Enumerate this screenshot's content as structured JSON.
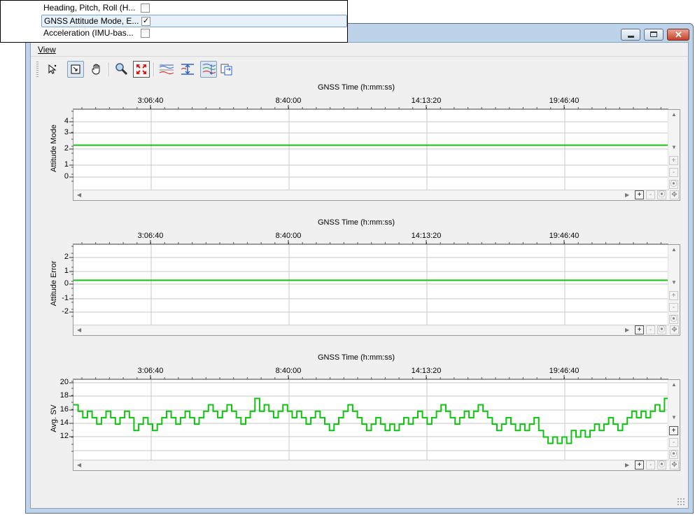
{
  "menu": {
    "view_label": "View"
  },
  "popup": {
    "items": [
      {
        "label": "Heading, Pitch, Roll (H...",
        "checked": false
      },
      {
        "label": "GNSS Attitude Mode, E...",
        "checked": true
      },
      {
        "label": "Acceleration (IMU-bas...",
        "checked": false
      }
    ]
  },
  "toolbar": {
    "buttons": [
      "select-pointer-icon",
      "zoom-box-icon",
      "pan-hand-icon",
      "magnifier-icon",
      "zoom-extents-icon",
      "multiple-series-icon",
      "vertical-scale-icon",
      "stacked-plots-icon",
      "sync-plots-icon"
    ]
  },
  "colors": {
    "series": "#0fc40f",
    "cursor": "#e01010",
    "grid": "#c8c8c8"
  },
  "x_axis": {
    "title": "GNSS Time (h:mm:ss)",
    "tick_labels": [
      "3:06:40",
      "8:40:00",
      "14:13:20",
      "19:46:40"
    ]
  },
  "scroll_buttons": {
    "plus": "+",
    "minus": "-"
  },
  "chart_data": [
    {
      "type": "line",
      "title": "GNSS Time (h:mm:ss)",
      "xlabel": "GNSS Time (h:mm:ss)",
      "ylabel": "Attitude Mode",
      "ylim": [
        -1,
        5
      ],
      "y_ticks": [
        "4",
        "3",
        "2",
        "1",
        "0"
      ],
      "x_ticks": [
        "3:06:40",
        "8:40:00",
        "14:13:20",
        "19:46:40"
      ],
      "x_start_hours": 0.0,
      "x_end_hours": 24.7,
      "series": [
        {
          "values": [
            2,
            2
          ]
        }
      ]
    },
    {
      "type": "line",
      "title": "GNSS Time (h:mm:ss)",
      "xlabel": "GNSS Time (h:mm:ss)",
      "ylabel": "Attitude Error",
      "ylim": [
        -3,
        3
      ],
      "y_ticks": [
        "2",
        "1",
        "0",
        "-1",
        "-2"
      ],
      "x_ticks": [
        "3:06:40",
        "8:40:00",
        "14:13:20",
        "19:46:40"
      ],
      "x_start_hours": 0.0,
      "x_end_hours": 24.7,
      "series": [
        {
          "values": [
            0,
            0
          ]
        }
      ]
    },
    {
      "type": "line",
      "title": "GNSS Time (h:mm:ss)",
      "xlabel": "GNSS Time (h:mm:ss)",
      "ylabel": "Avg. SV",
      "ylim": [
        10,
        21
      ],
      "y_ticks": [
        "20",
        "18",
        "16",
        "14",
        "12"
      ],
      "x_ticks": [
        "3:06:40",
        "8:40:00",
        "14:13:20",
        "19:46:40"
      ],
      "x_start_hours": 0.0,
      "x_end_hours": 24.7,
      "series": [
        {
          "values": [
            18,
            17,
            16,
            17,
            16,
            15,
            16,
            17,
            16,
            15,
            16,
            17,
            16,
            14,
            15,
            16,
            15,
            14,
            15,
            16,
            17,
            16,
            15,
            16,
            17,
            16,
            15,
            16,
            17,
            18,
            17,
            16,
            17,
            18,
            17,
            16,
            15,
            16,
            17,
            19,
            17,
            18,
            17,
            16,
            17,
            18,
            17,
            16,
            17,
            16,
            15,
            16,
            17,
            16,
            15,
            14,
            15,
            16,
            17,
            18,
            17,
            16,
            15,
            14,
            15,
            16,
            15,
            14,
            15,
            14,
            15,
            16,
            15,
            16,
            17,
            16,
            15,
            16,
            17,
            18,
            17,
            16,
            15,
            16,
            17,
            16,
            17,
            18,
            17,
            16,
            15,
            14,
            15,
            16,
            15,
            14,
            15,
            14,
            15,
            16,
            14,
            13,
            12,
            13,
            12,
            13,
            12,
            14,
            13,
            14,
            13,
            14,
            15,
            14,
            15,
            16,
            15,
            14,
            15,
            16,
            17,
            16,
            17,
            16,
            17,
            18,
            17,
            19
          ]
        }
      ]
    }
  ]
}
